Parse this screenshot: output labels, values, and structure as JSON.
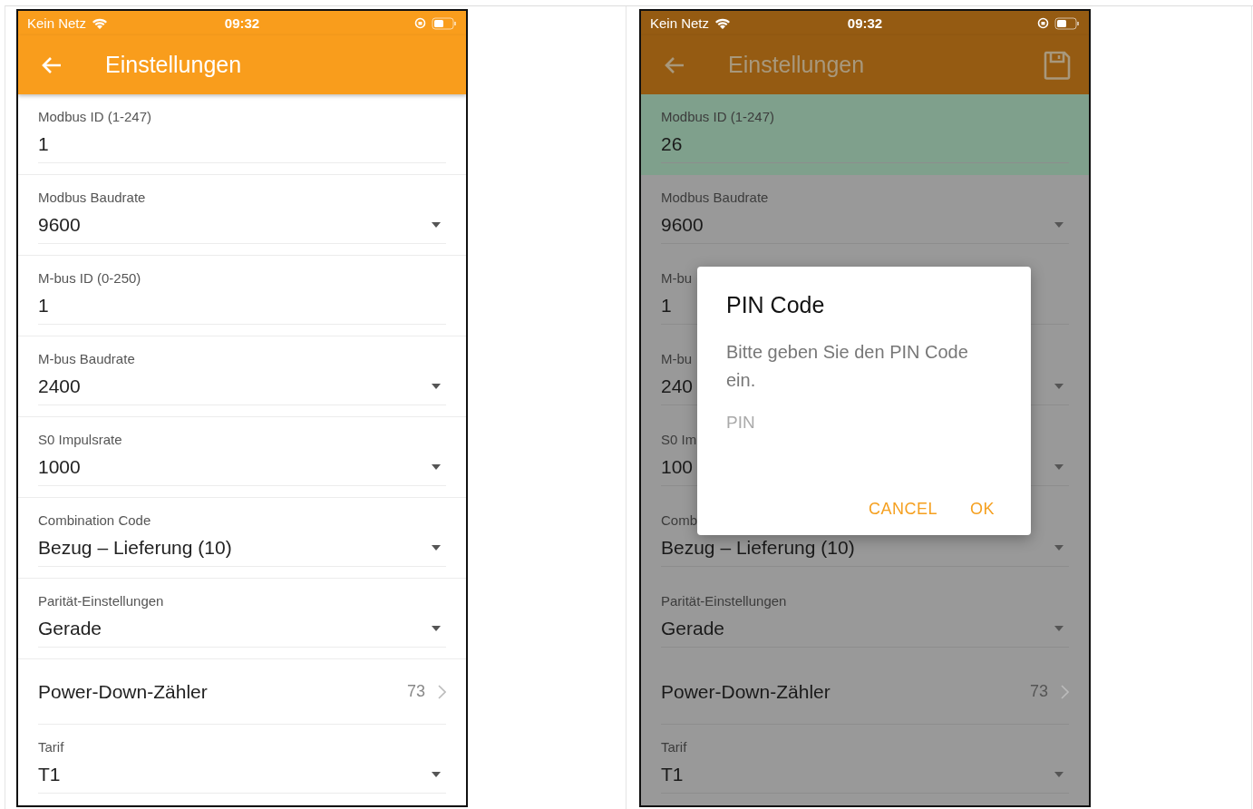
{
  "screens": [
    {
      "dimmed": false,
      "status_bar": {
        "carrier": "Kein Netz",
        "time": "09:32"
      },
      "app_bar": {
        "title": "Einstellungen"
      },
      "fields": [
        {
          "kind": "text",
          "label": "Modbus ID (1-247)",
          "value": "1",
          "highlighted": false
        },
        {
          "kind": "select",
          "label": "Modbus Baudrate",
          "value": "9600",
          "highlighted": false
        },
        {
          "kind": "text",
          "label": "M-bus ID (0-250)",
          "value": "1",
          "highlighted": false
        },
        {
          "kind": "select",
          "label": "M-bus Baudrate",
          "value": "2400",
          "highlighted": false
        },
        {
          "kind": "select",
          "label": "S0 Impulsrate",
          "value": "1000",
          "highlighted": false
        },
        {
          "kind": "select",
          "label": "Combination Code",
          "value": "Bezug – Lieferung (10)",
          "highlighted": false
        },
        {
          "kind": "select",
          "label": "Parität-Einstellungen",
          "value": "Gerade",
          "highlighted": false
        },
        {
          "kind": "link",
          "label": "Power-Down-Zähler",
          "value": "73",
          "highlighted": false
        },
        {
          "kind": "select",
          "label": "Tarif",
          "value": "T1",
          "highlighted": false
        }
      ]
    },
    {
      "dimmed": true,
      "status_bar": {
        "carrier": "Kein Netz",
        "time": "09:32"
      },
      "app_bar": {
        "title": "Einstellungen",
        "actions": [
          {
            "kind": "save"
          }
        ]
      },
      "fields": [
        {
          "kind": "text",
          "label": "Modbus ID (1-247)",
          "value": "26",
          "highlighted": true
        },
        {
          "kind": "select",
          "label": "Modbus Baudrate",
          "value": "9600",
          "highlighted": false
        },
        {
          "kind": "text",
          "label": "M-bu",
          "value": "1",
          "highlighted": false
        },
        {
          "kind": "select",
          "label": "M-bu",
          "value": "240",
          "highlighted": false
        },
        {
          "kind": "select",
          "label": "S0 Im",
          "value": "100",
          "highlighted": false
        },
        {
          "kind": "select",
          "label": "Comb",
          "value": "Bezug – Lieferung (10)",
          "highlighted": false
        },
        {
          "kind": "select",
          "label": "Parität-Einstellungen",
          "value": "Gerade",
          "highlighted": false
        },
        {
          "kind": "link",
          "label": "Power-Down-Zähler",
          "value": "73",
          "highlighted": false
        },
        {
          "kind": "select",
          "label": "Tarif",
          "value": "T1",
          "highlighted": false
        }
      ],
      "dialog": {
        "title": "PIN Code",
        "message": "Bitte geben Sie den PIN Code ein.",
        "input": {
          "placeholder": "PIN"
        },
        "buttons": [
          "CANCEL",
          "OK"
        ]
      }
    }
  ]
}
